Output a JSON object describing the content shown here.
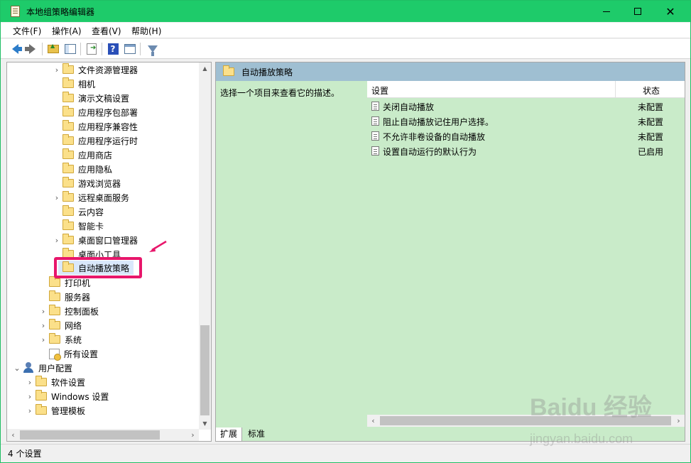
{
  "window": {
    "title": "本地组策略编辑器",
    "accent": "#1ecb6a"
  },
  "menu": [
    "文件(F)",
    "操作(A)",
    "查看(V)",
    "帮助(H)"
  ],
  "tree": [
    {
      "label": "文件资源管理器",
      "exp": ">"
    },
    {
      "label": "相机",
      "exp": ""
    },
    {
      "label": "演示文稿设置",
      "exp": ""
    },
    {
      "label": "应用程序包部署",
      "exp": ""
    },
    {
      "label": "应用程序兼容性",
      "exp": ""
    },
    {
      "label": "应用程序运行时",
      "exp": ""
    },
    {
      "label": "应用商店",
      "exp": ""
    },
    {
      "label": "应用隐私",
      "exp": ""
    },
    {
      "label": "游戏浏览器",
      "exp": ""
    },
    {
      "label": "远程桌面服务",
      "exp": ">"
    },
    {
      "label": "云内容",
      "exp": ""
    },
    {
      "label": "智能卡",
      "exp": ""
    },
    {
      "label": "桌面窗口管理器",
      "exp": ">"
    },
    {
      "label": "桌面小工具",
      "exp": ""
    },
    {
      "label": "自动播放策略",
      "exp": ""
    },
    {
      "label": "打印机",
      "exp": ""
    },
    {
      "label": "服务器",
      "exp": ""
    },
    {
      "label": "控制面板",
      "exp": ">"
    },
    {
      "label": "网络",
      "exp": ">"
    },
    {
      "label": "系统",
      "exp": ">"
    },
    {
      "label": "所有设置",
      "exp": ""
    },
    {
      "label": "用户配置",
      "exp": "v"
    },
    {
      "label": "软件设置",
      "exp": ">"
    },
    {
      "label": "Windows 设置",
      "exp": ">"
    },
    {
      "label": "管理模板",
      "exp": ">"
    }
  ],
  "right": {
    "header": "自动播放策略",
    "description": "选择一个项目来查看它的描述。",
    "columns": {
      "setting": "设置",
      "state": "状态"
    },
    "rows": [
      {
        "name": "关闭自动播放",
        "state": "未配置"
      },
      {
        "name": "阻止自动播放记住用户选择。",
        "state": "未配置"
      },
      {
        "name": "不允许非卷设备的自动播放",
        "state": "未配置"
      },
      {
        "name": "设置自动运行的默认行为",
        "state": "已启用"
      }
    ]
  },
  "tabs": {
    "extended": "扩展",
    "standard": "标准"
  },
  "status": "4 个设置",
  "watermark": {
    "logo": "Baidu 经验",
    "sub": "jingyan.baidu.com"
  }
}
